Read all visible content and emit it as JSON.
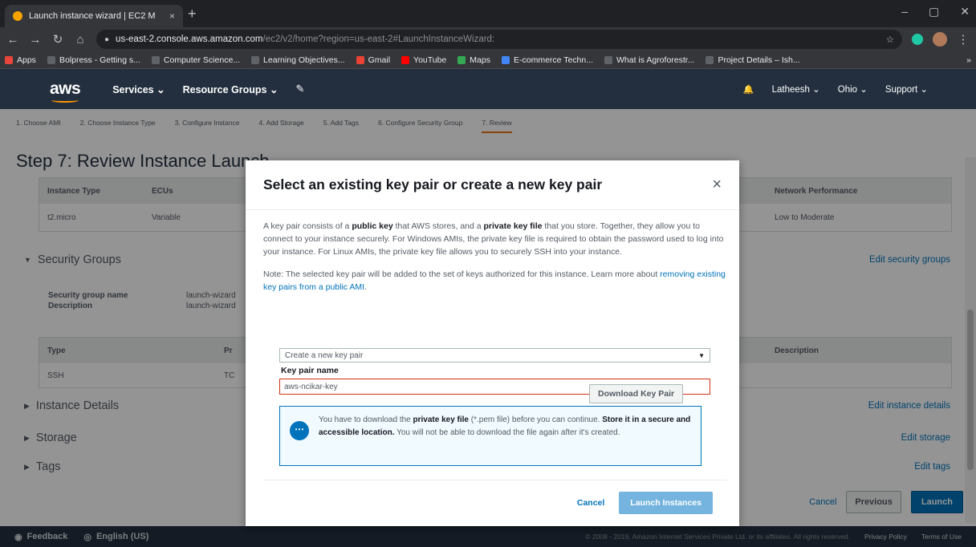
{
  "browser": {
    "tab_title": "Launch instance wizard | EC2 M",
    "tab_close": "×",
    "new_tab": "+",
    "win_min": "–",
    "win_max": "▢",
    "win_close": "✕",
    "back": "←",
    "forward": "→",
    "reload": "↻",
    "home": "⌂",
    "url_host": "us-east-2.console.aws.amazon.com",
    "url_path": "/ec2/v2/home?region=us-east-2#LaunchInstanceWizard:",
    "star": "☆",
    "menu": "⋮",
    "bookmarks": [
      {
        "label": "Apps",
        "color": "#e8453c"
      },
      {
        "label": "Bolpress - Getting s...",
        "color": "#5f6368"
      },
      {
        "label": "Computer Science...",
        "color": "#5f6368"
      },
      {
        "label": "Learning Objectives...",
        "color": "#5f6368"
      },
      {
        "label": "Gmail",
        "color": "#ea4335"
      },
      {
        "label": "YouTube",
        "color": "#ff0000"
      },
      {
        "label": "Maps",
        "color": "#34a853"
      },
      {
        "label": "E-commerce Techn...",
        "color": "#4285f4"
      },
      {
        "label": "What is Agroforestr...",
        "color": "#5f6368"
      },
      {
        "label": "Project Details – Ish...",
        "color": "#5f6368"
      }
    ],
    "bookmarks_more": "»"
  },
  "aws_nav": {
    "logo": "aws",
    "services": "Services ⌄",
    "resource_groups": "Resource Groups ⌄",
    "pin": "✎",
    "bell": "🔔",
    "account": "Latheesh ⌄",
    "region": "Ohio ⌄",
    "support": "Support ⌄"
  },
  "wizard": {
    "steps": [
      "1. Choose AMI",
      "2. Choose Instance Type",
      "3. Configure Instance",
      "4. Add Storage",
      "5. Add Tags",
      "6. Configure Security Group",
      "7. Review"
    ],
    "title": "Step 7: Review Instance Launch"
  },
  "instance_table": {
    "headers": {
      "type": "Instance Type",
      "ecus": "ECUs",
      "network": "Network Performance"
    },
    "row": {
      "type": "t2.micro",
      "ecus": "Variable",
      "network": "Low to Moderate"
    }
  },
  "security_groups": {
    "title": "Security Groups",
    "edit": "Edit security groups",
    "name_label": "Security group name",
    "name_value": "launch-wizard",
    "desc_label": "Description",
    "desc_value": "launch-wizard",
    "rules_headers": {
      "type": "Type",
      "protocol": "Pr",
      "description": "Description"
    },
    "rules_row": {
      "type": "SSH",
      "protocol": "TC"
    }
  },
  "sections": {
    "instance_details": "Instance Details",
    "instance_details_edit": "Edit instance details",
    "storage": "Storage",
    "storage_edit": "Edit storage",
    "tags": "Tags",
    "tags_edit": "Edit tags"
  },
  "page_actions": {
    "cancel": "Cancel",
    "previous": "Previous",
    "launch": "Launch"
  },
  "footer": {
    "feedback": "Feedback",
    "language": "English (US)",
    "copyright": "© 2008 - 2019, Amazon Internet Services Private Ltd. or its affiliates. All rights reserved.",
    "privacy": "Privacy Policy",
    "terms": "Terms of Use"
  },
  "modal": {
    "title": "Select an existing key pair or create a new key pair",
    "close": "×",
    "para1_a": "A key pair consists of a ",
    "para1_b": "public key",
    "para1_c": " that AWS stores, and a ",
    "para1_d": "private key file",
    "para1_e": " that you store. Together, they allow you to connect to your instance securely. For Windows AMIs, the private key file is required to obtain the password used to log into your instance. For Linux AMIs, the private key file allows you to securely SSH into your instance.",
    "note_a": "Note: The selected key pair will be added to the set of keys authorized for this instance. Learn more about ",
    "note_link": "removing existing key pairs from a public AMI",
    "note_b": ".",
    "select_value": "Create a new key pair",
    "key_pair_label": "Key pair name",
    "key_pair_value": "aws-ncikar-key",
    "download": "Download Key Pair",
    "info_a": "You have to download the ",
    "info_b": "private key file",
    "info_c": " (*.pem file) before you can continue. ",
    "info_d": "Store it in a secure and accessible location.",
    "info_e": " You will not be able to download the file again after it's created.",
    "cancel": "Cancel",
    "launch": "Launch Instances"
  }
}
